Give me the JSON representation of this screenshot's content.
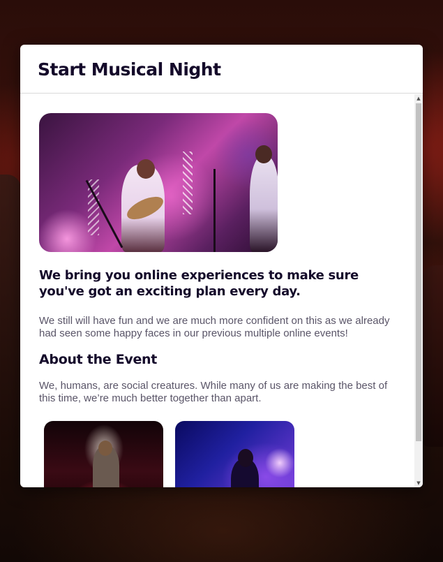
{
  "modal": {
    "title": "Start Musical Night",
    "headline": "We bring you online experiences to make sure you've got an exciting plan every day.",
    "intro": "We still will have fun and we are much more confident on this as we already had seen some happy faces in our previous multiple online events!",
    "about_heading": "About the Event",
    "about_text": "We, humans, are social creatures. While many of us are making the best of this time, we’re much better together than apart."
  },
  "images": {
    "hero": "band-performing-image",
    "gallery": [
      "rapper-performing-image",
      "singer-performing-image"
    ]
  },
  "icons": {
    "scroll_up": "triangle-up-icon",
    "scroll_down": "triangle-down-icon"
  },
  "scroll": {
    "position": 0
  }
}
